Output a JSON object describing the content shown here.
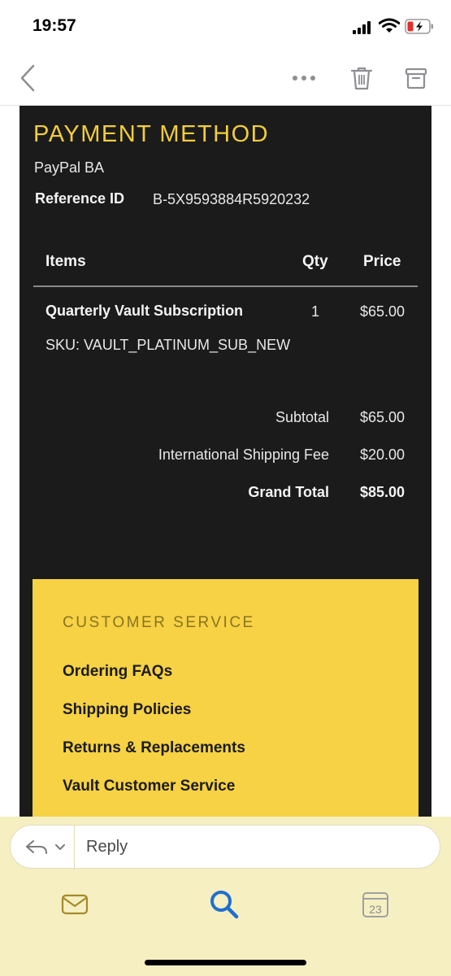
{
  "status_bar": {
    "time": "19:57"
  },
  "nav": {
    "icons": [
      "chevron-left-icon",
      "more-icon",
      "trash-icon",
      "archive-icon"
    ]
  },
  "payment": {
    "heading": "PAYMENT METHOD",
    "method": "PayPal BA",
    "reference_label": "Reference ID",
    "reference_value": "B-5X9593884R5920232"
  },
  "table": {
    "headers": {
      "items": "Items",
      "qty": "Qty",
      "price": "Price"
    },
    "rows": [
      {
        "name": "Quarterly Vault Subscription",
        "qty": "1",
        "price": "$65.00",
        "sku": "SKU: VAULT_PLATINUM_SUB_NEW"
      }
    ]
  },
  "totals": {
    "subtotal_label": "Subtotal",
    "subtotal_value": "$65.00",
    "shipping_label": "International Shipping Fee",
    "shipping_value": "$20.00",
    "grand_label": "Grand Total",
    "grand_value": "$85.00"
  },
  "customer_service": {
    "heading": "CUSTOMER SERVICE",
    "links": [
      "Ordering FAQs",
      "Shipping Policies",
      "Returns & Replacements",
      "Vault Customer Service"
    ]
  },
  "reply": {
    "placeholder": "Reply"
  },
  "tab_bar": {
    "calendar_day": "23",
    "icons": [
      "mail-icon",
      "search-icon",
      "calendar-icon"
    ]
  },
  "colors": {
    "email_background": "#1b1b1b",
    "accent_yellow": "#f2cd3b",
    "cs_box": "#f6d244",
    "bottom_bar": "#f6efc1",
    "ios_blue": "#1f6fd1"
  }
}
